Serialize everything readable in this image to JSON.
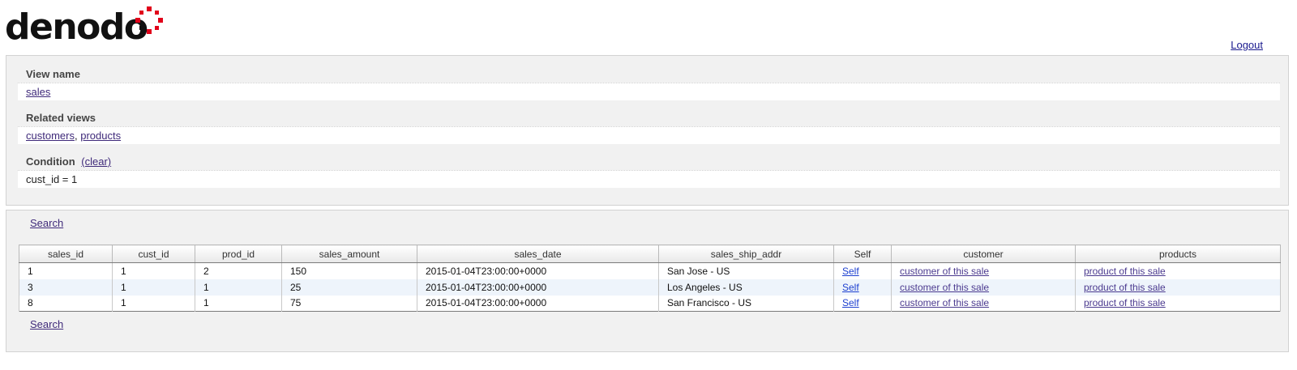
{
  "header": {
    "logo_text": "denodo",
    "logout_label": "Logout",
    "brand_color": "#e1001a"
  },
  "info": {
    "view_name_label": "View name",
    "view_name_value": "sales",
    "related_views_label": "Related views",
    "related_views": [
      "customers",
      "products"
    ],
    "related_views_separator": ",",
    "condition_label": "Condition",
    "condition_clear_label": "(clear)",
    "condition_value": "cust_id = 1"
  },
  "results": {
    "search_top_label": "Search",
    "search_bottom_label": "Search",
    "columns": [
      "sales_id",
      "cust_id",
      "prod_id",
      "sales_amount",
      "sales_date",
      "sales_ship_addr",
      "Self",
      "customer",
      "products"
    ],
    "rows": [
      {
        "sales_id": "1",
        "cust_id": "1",
        "prod_id": "2",
        "sales_amount": "150",
        "sales_date": "2015-01-04T23:00:00+0000",
        "sales_ship_addr": "San Jose - US",
        "self": "Self",
        "customer": "customer of this sale",
        "products": "product of this sale"
      },
      {
        "sales_id": "3",
        "cust_id": "1",
        "prod_id": "1",
        "sales_amount": "25",
        "sales_date": "2015-01-04T23:00:00+0000",
        "sales_ship_addr": "Los Angeles - US",
        "self": "Self",
        "customer": "customer of this sale",
        "products": "product of this sale"
      },
      {
        "sales_id": "8",
        "cust_id": "1",
        "prod_id": "1",
        "sales_amount": "75",
        "sales_date": "2015-01-04T23:00:00+0000",
        "sales_ship_addr": "San Francisco - US",
        "self": "Self",
        "customer": "customer of this sale",
        "products": "product of this sale"
      }
    ]
  }
}
